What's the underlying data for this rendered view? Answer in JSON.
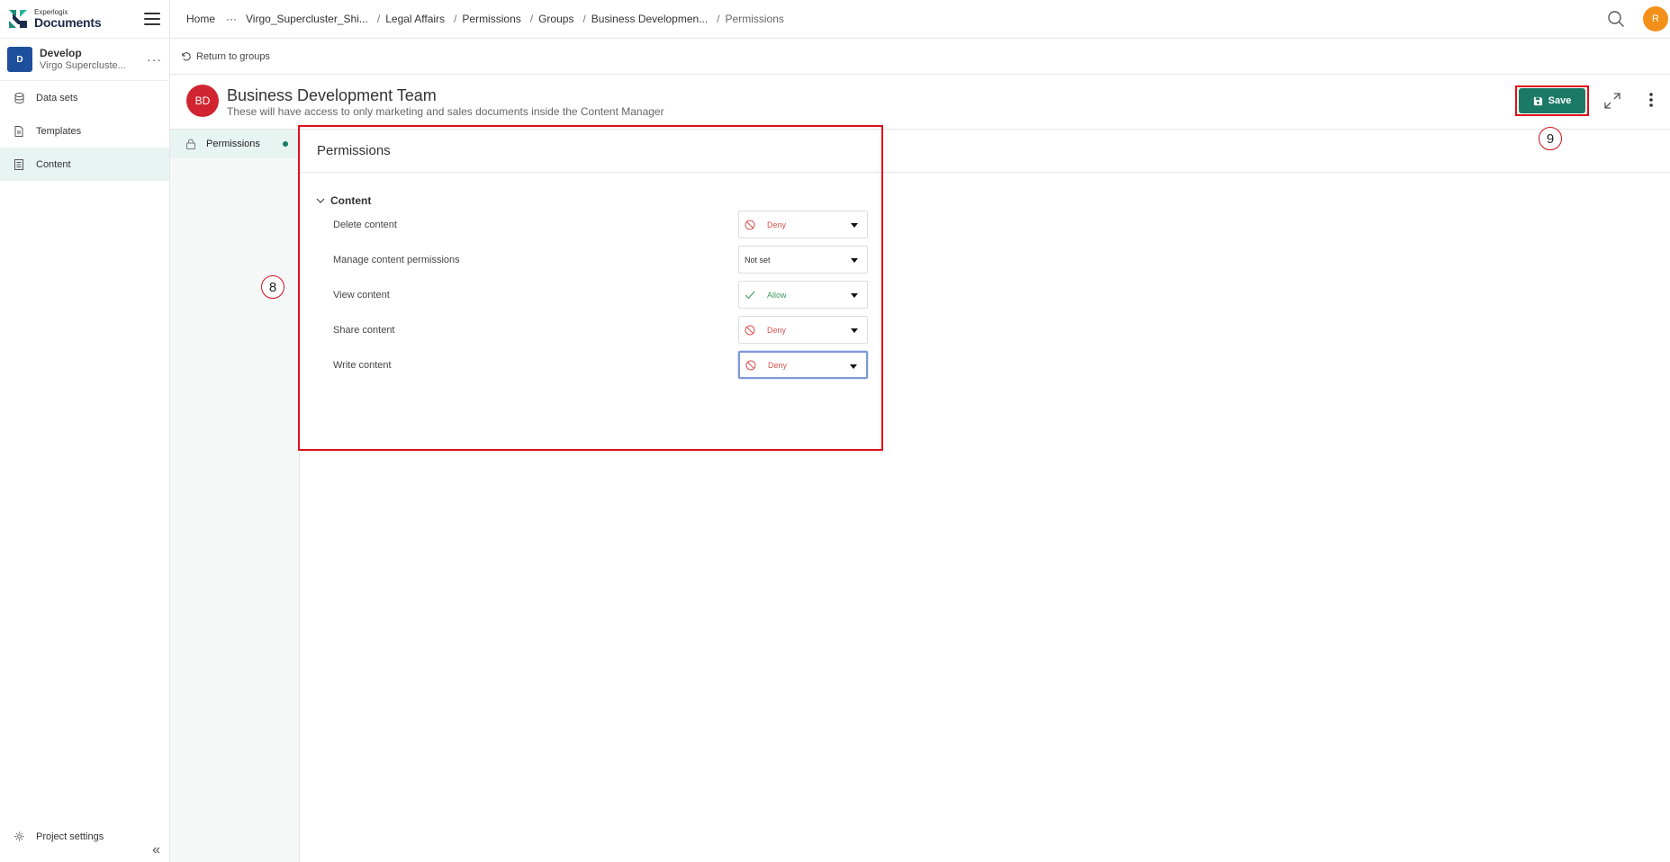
{
  "app": {
    "logo_small": "Experlogix",
    "logo_big": "Documents"
  },
  "project": {
    "badge": "D",
    "name": "Develop",
    "sub": "Virgo Supercluste...",
    "more": "···"
  },
  "sidebar": {
    "items": [
      {
        "label": "Data sets",
        "icon": "database-icon"
      },
      {
        "label": "Templates",
        "icon": "file-icon"
      },
      {
        "label": "Content",
        "icon": "content-icon",
        "active": true
      }
    ],
    "settings_label": "Project settings",
    "collapse_glyph": "«"
  },
  "breadcrumb": {
    "home": "Home",
    "ellipsis": "···",
    "items": [
      "Virgo_Supercluster_Shi...",
      "Legal Affairs",
      "Permissions",
      "Groups",
      "Business Developmen...",
      "Permissions"
    ]
  },
  "user": {
    "initial": "R"
  },
  "return_label": "Return to groups",
  "group": {
    "initials": "BD",
    "title": "Business Development Team",
    "description": "These will have access to only marketing and sales documents inside the Content Manager"
  },
  "toolbar": {
    "save_label": "Save"
  },
  "tabs": [
    {
      "label": "Permissions"
    }
  ],
  "permissions": {
    "heading": "Permissions",
    "section": "Content",
    "rows": [
      {
        "label": "Delete content",
        "value": "Deny",
        "state": "deny"
      },
      {
        "label": "Manage content permissions",
        "value": "Not set",
        "state": "notset"
      },
      {
        "label": "View content",
        "value": "Allow",
        "state": "allow"
      },
      {
        "label": "Share content",
        "value": "Deny",
        "state": "deny"
      },
      {
        "label": "Write content",
        "value": "Deny",
        "state": "deny"
      }
    ]
  },
  "markers": {
    "panel": "8",
    "save": "9"
  },
  "colors": {
    "accent": "#1a7a65",
    "highlight": "#e0101a",
    "deny": "#d9534f",
    "allow": "#3c9a5f"
  }
}
